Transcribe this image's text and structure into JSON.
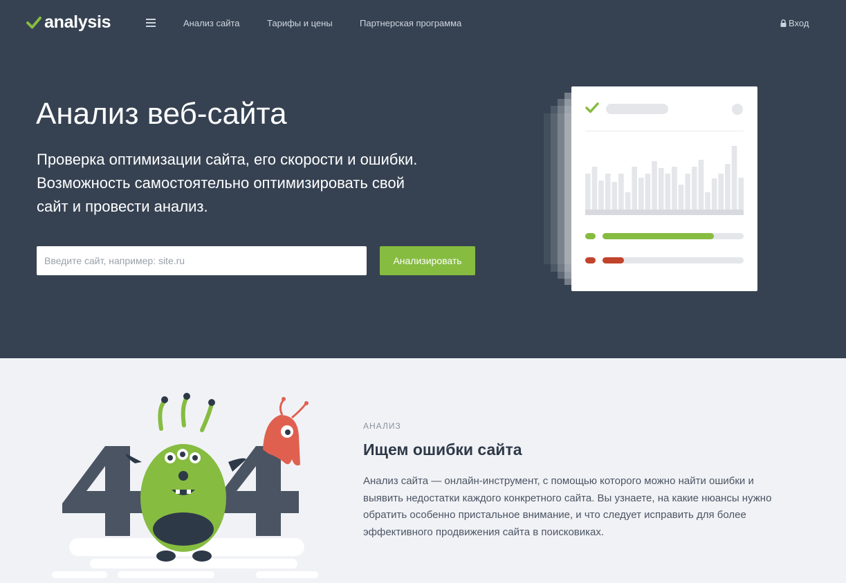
{
  "nav": {
    "logo_text": "analysis",
    "links": [
      "Анализ сайта",
      "Тарифы и цены",
      "Партнерская программа"
    ],
    "login_label": "Вход"
  },
  "hero": {
    "title": "Анализ веб-сайта",
    "subtitle_lines": [
      "Проверка оптимизации сайта, его скорости и ошибки.",
      "Возможность самостоятельно оптимизировать свой",
      "сайт и провести анализ."
    ],
    "search": {
      "placeholder": "Введите сайт, например: site.ru",
      "value": ""
    },
    "button_label": "Анализировать"
  },
  "card": {
    "progress": [
      {
        "status": "good",
        "fraction": 0.79
      },
      {
        "status": "bad",
        "fraction": 0.15
      }
    ]
  },
  "section": {
    "label": "АНАЛИЗ",
    "title": "Ищем ошибки сайта",
    "text_lines": [
      "Анализ сайта — онлайн-инструмент, с помощью которого можно найти ошибки и",
      "выявить недостатки каждого конкретного сайта. Вы узнаете, на какие нюансы нужно",
      "обратить особенно пристальное внимание, и что следует исправить для более",
      "эффективного продвижения сайта в поисковиках."
    ]
  },
  "illustration": {
    "caption": "404"
  },
  "colors": {
    "hero_bg": "#364252",
    "accent_green": "#86bc40",
    "error_red": "#c2432b",
    "page_bg": "#f1f2f6"
  },
  "icons": {
    "logo": "checkmark-icon",
    "menu": "hamburger-icon",
    "login": "lock-icon"
  }
}
